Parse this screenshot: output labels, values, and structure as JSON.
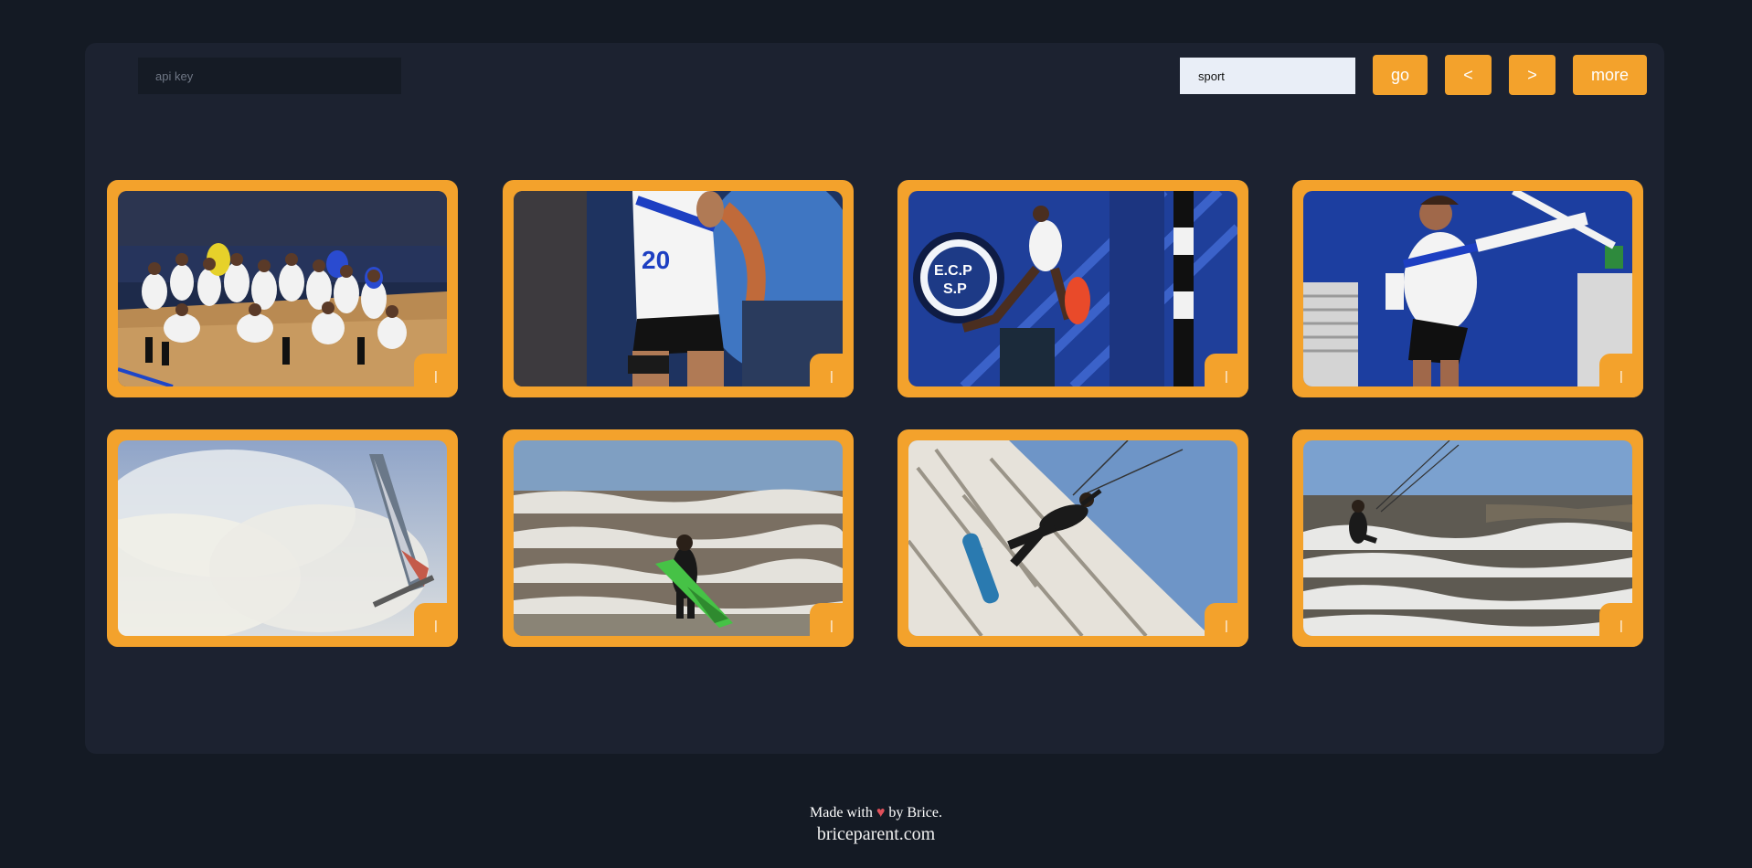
{
  "header": {
    "api_key_placeholder": "api key",
    "search_value": "sport",
    "go_label": "go",
    "prev_label": "<",
    "next_label": ">",
    "more_label": "more"
  },
  "cards": [
    {
      "action_label": "|",
      "scene": "team-photo-indoor-court"
    },
    {
      "action_label": "|",
      "scene": "player-thumbs-up-closeup"
    },
    {
      "action_label": "|",
      "scene": "handball-jump-shot"
    },
    {
      "action_label": "|",
      "scene": "player-throwing"
    },
    {
      "action_label": "|",
      "scene": "windsurf-in-spray"
    },
    {
      "action_label": "|",
      "scene": "surfer-entering-waves"
    },
    {
      "action_label": "|",
      "scene": "kitesurfer-jump"
    },
    {
      "action_label": "|",
      "scene": "kitesurfer-in-rough-sea"
    }
  ],
  "footer": {
    "made_with": "Made with",
    "heart_icon": "♥",
    "by": "by Brice.",
    "site": "briceparent.com"
  },
  "colors": {
    "accent": "#f3a22c",
    "background": "#141a24",
    "panel": "#1c2230"
  }
}
